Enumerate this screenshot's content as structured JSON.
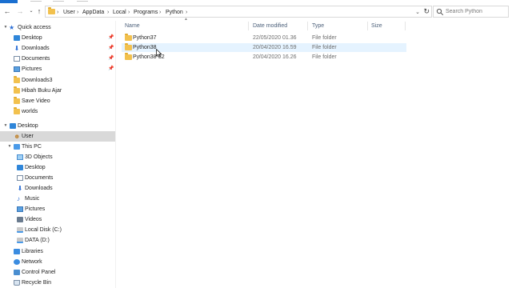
{
  "window": {
    "accent": "#1a6fd0"
  },
  "ribbon": {
    "tabs": [
      "file-tab",
      "home-tab",
      "share-tab",
      "view-tab"
    ]
  },
  "navigation": {
    "back_icon": "back-arrow-icon",
    "forward_icon": "forward-arrow-icon",
    "recent_icon": "chevron-down-icon",
    "up_icon": "up-arrow-icon"
  },
  "address_bar": {
    "crumbs": [
      "User",
      "AppData",
      "Local",
      "Programs",
      "Python"
    ]
  },
  "search": {
    "placeholder": "Search Python"
  },
  "nav_pane": {
    "quick_access": {
      "label": "Quick access",
      "icon": "star-icon"
    },
    "pinned": [
      {
        "label": "Desktop",
        "icon": "desktop-icon"
      },
      {
        "label": "Downloads",
        "icon": "download-icon"
      },
      {
        "label": "Documents",
        "icon": "documents-icon"
      },
      {
        "label": "Pictures",
        "icon": "pictures-icon"
      }
    ],
    "recent": [
      {
        "label": "Downloads3"
      },
      {
        "label": "Hibah Buku Ajar"
      },
      {
        "label": "Save Video"
      },
      {
        "label": "worlds"
      }
    ],
    "desktop": {
      "label": "Desktop"
    },
    "user": {
      "label": "User"
    },
    "this_pc": {
      "label": "This PC"
    },
    "pc_items": [
      {
        "label": "3D Objects",
        "icon": "3d-objects-icon"
      },
      {
        "label": "Desktop",
        "icon": "desktop-icon"
      },
      {
        "label": "Documents",
        "icon": "documents-icon"
      },
      {
        "label": "Downloads",
        "icon": "download-icon"
      },
      {
        "label": "Music",
        "icon": "music-icon"
      },
      {
        "label": "Pictures",
        "icon": "pictures-icon"
      },
      {
        "label": "Videos",
        "icon": "videos-icon"
      },
      {
        "label": "Local Disk (C:)",
        "icon": "disk-icon"
      },
      {
        "label": "DATA (D:)",
        "icon": "disk-icon"
      }
    ],
    "bottom": [
      {
        "label": "Libraries",
        "icon": "libraries-icon"
      },
      {
        "label": "Network",
        "icon": "network-icon"
      },
      {
        "label": "Control Panel",
        "icon": "control-panel-icon"
      },
      {
        "label": "Recycle Bin",
        "icon": "recycle-bin-icon"
      }
    ]
  },
  "file_list": {
    "columns": {
      "name": "Name",
      "date": "Date modified",
      "type": "Type",
      "size": "Size"
    },
    "rows": [
      {
        "name": "Python37",
        "date": "22/05/2020 01.36",
        "type": "File folder",
        "size": ""
      },
      {
        "name": "Python38",
        "date": "20/04/2020 16.59",
        "type": "File folder",
        "size": ""
      },
      {
        "name": "Python38-32",
        "date": "20/04/2020 16.26",
        "type": "File folder",
        "size": ""
      }
    ],
    "hover_color": "#e5f3ff",
    "selected_nav_color": "#d9d9d9"
  }
}
